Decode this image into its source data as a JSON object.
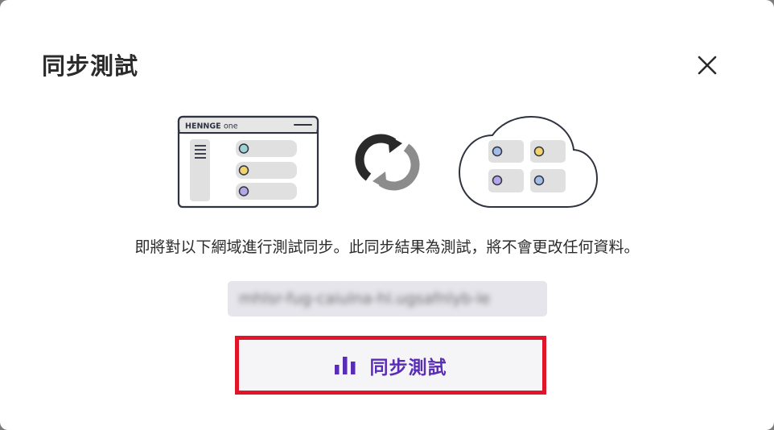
{
  "dialog": {
    "title": "同步測試",
    "description": "即將對以下網域進行測試同步。此同步結果為測試，將不會更改任何資料。",
    "domain": "mhlsr-fug-caiulna-hl.ugsafnlyb-le",
    "illustration": {
      "app_brand": "HENNGE",
      "app_brand_suffix": "one"
    },
    "sync_button": {
      "label": "同步測試",
      "icon": "bar-chart-icon"
    },
    "close_icon": "close-icon"
  },
  "colors": {
    "primary": "#5a2db5",
    "highlight_border": "#e0152a",
    "button_bg": "#f5f5f7",
    "domain_bg": "#e6e5eb",
    "dot_teal": "#9fd3d3",
    "dot_yellow": "#f3d36b",
    "dot_purple": "#b4a6e8",
    "dot_blue": "#a3bde8"
  }
}
